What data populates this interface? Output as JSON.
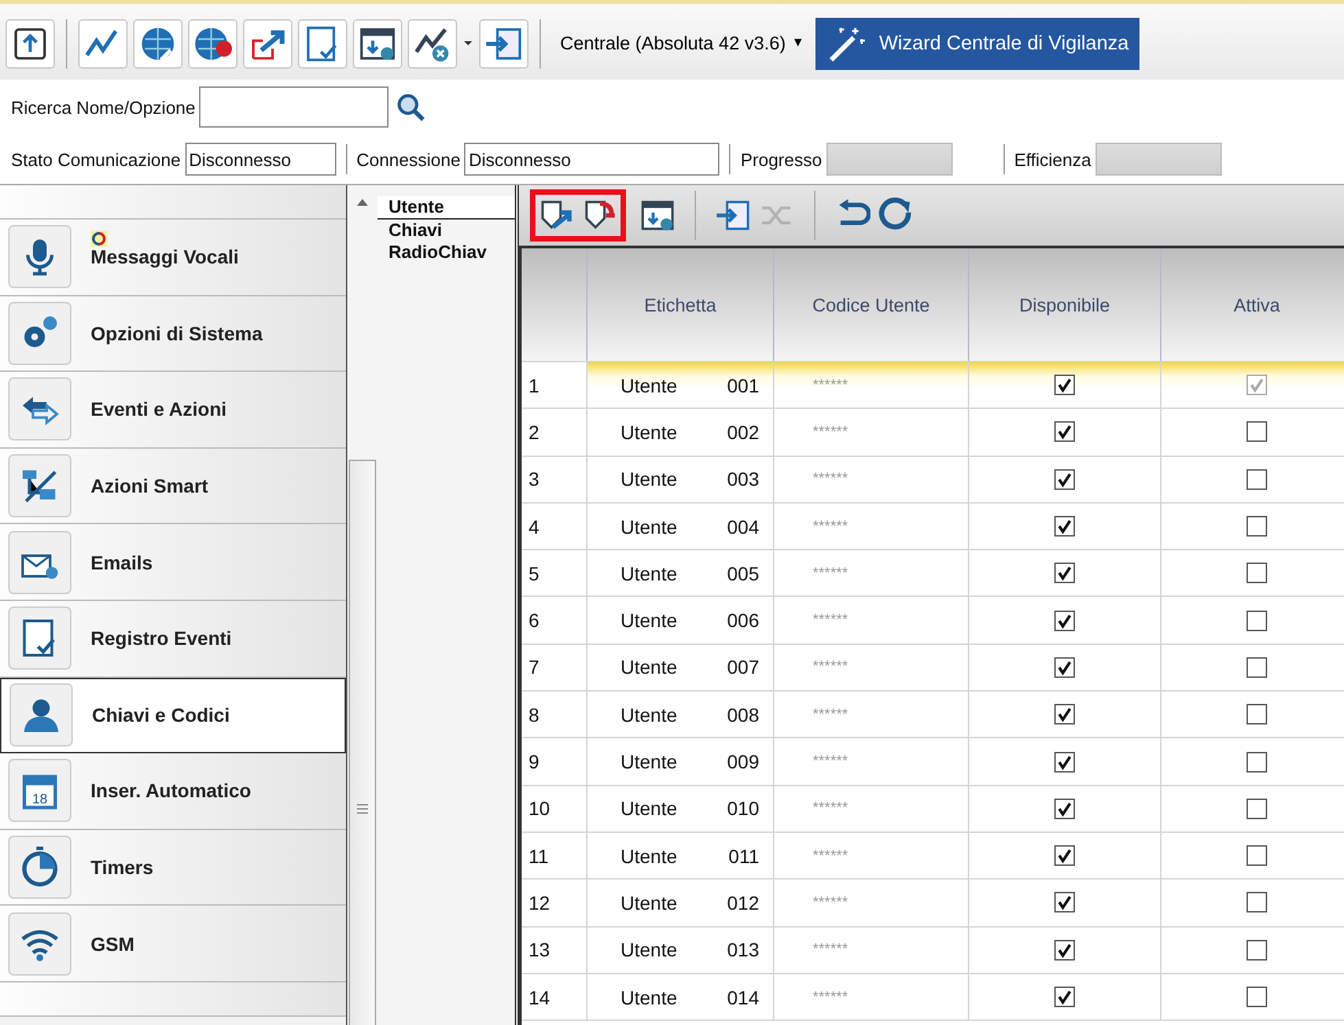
{
  "toolbar": {
    "buttons": [
      {
        "kind": "save"
      },
      {
        "kind": "chart"
      },
      {
        "kind": "globe-up"
      },
      {
        "kind": "globe-down"
      },
      {
        "kind": "export"
      },
      {
        "kind": "checklist"
      },
      {
        "kind": "window-down"
      },
      {
        "kind": "chart-x"
      },
      {
        "kind": "caret"
      },
      {
        "kind": "import"
      }
    ],
    "device": {
      "label": "Centrale (Absoluta 42 v3.6)",
      "caret": "▾"
    },
    "wizard": {
      "label": "Wizard Centrale di Vigilanza"
    }
  },
  "search": {
    "label": "Ricerca Nome/Opzione"
  },
  "status": [
    {
      "kind": "field",
      "label": "Stato Comunicazione",
      "value": "Disconnesso"
    },
    {
      "kind": "field",
      "label": "Connessione",
      "value": "Disconnesso"
    },
    {
      "kind": "bar",
      "label": "Progresso",
      "level": 0
    },
    {
      "kind": "bar",
      "label": "Efficienza",
      "level": 0
    }
  ],
  "sidebar": {
    "items": [
      {
        "kind": "mic",
        "label": "Messaggi Vocali",
        "selected": false,
        "badge": true
      },
      {
        "kind": "gears",
        "label": "Opzioni di Sistema",
        "selected": false,
        "badge": false
      },
      {
        "kind": "arrows",
        "label": "Eventi e Azioni",
        "selected": false,
        "badge": false
      },
      {
        "kind": "smart",
        "label": "Azioni Smart",
        "selected": false,
        "badge": false
      },
      {
        "kind": "email",
        "label": "Emails",
        "selected": false,
        "badge": false
      },
      {
        "kind": "log",
        "label": "Registro Eventi",
        "selected": false,
        "badge": false
      },
      {
        "kind": "user",
        "label": "Chiavi e Codici",
        "selected": true,
        "badge": false
      },
      {
        "kind": "calendar",
        "label": "Inser. Automatico",
        "selected": false,
        "badge": false,
        "icon_text": "18"
      },
      {
        "kind": "timer",
        "label": "Timers",
        "selected": false,
        "badge": false
      },
      {
        "kind": "wifi",
        "label": "GSM",
        "selected": false,
        "badge": false
      }
    ]
  },
  "tree": {
    "items": [
      {
        "label": "Utente",
        "selected": true
      },
      {
        "label": "Chiavi",
        "selected": false
      },
      {
        "label": "RadioChiav",
        "selected": false
      }
    ]
  },
  "grid_toolbar": {
    "groups": [
      {
        "highlighted": true,
        "buttons": [
          {
            "kind": "shield-up",
            "disabled": false
          },
          {
            "kind": "shield-down",
            "disabled": false
          }
        ]
      },
      {
        "highlighted": false,
        "buttons": [
          {
            "kind": "window-down",
            "disabled": false
          }
        ]
      },
      {
        "highlighted": false,
        "buttons": [
          {
            "kind": "import",
            "disabled": false
          },
          {
            "kind": "shuffle",
            "disabled": true
          }
        ]
      },
      {
        "highlighted": false,
        "buttons": [
          {
            "kind": "undo",
            "disabled": false
          },
          {
            "kind": "refresh",
            "disabled": false
          }
        ]
      }
    ]
  },
  "table": {
    "columns": [
      "Etichetta",
      "Codice Utente",
      "Disponibile",
      "Attiva"
    ],
    "rows": [
      {
        "index": "1",
        "label": "Utente",
        "number": "001",
        "code": "******",
        "available": true,
        "active": true,
        "active_disabled": true,
        "selected": true
      },
      {
        "index": "2",
        "label": "Utente",
        "number": "002",
        "code": "******",
        "available": true,
        "active": false,
        "active_disabled": false,
        "selected": false
      },
      {
        "index": "3",
        "label": "Utente",
        "number": "003",
        "code": "******",
        "available": true,
        "active": false,
        "active_disabled": false,
        "selected": false
      },
      {
        "index": "4",
        "label": "Utente",
        "number": "004",
        "code": "******",
        "available": true,
        "active": false,
        "active_disabled": false,
        "selected": false
      },
      {
        "index": "5",
        "label": "Utente",
        "number": "005",
        "code": "******",
        "available": true,
        "active": false,
        "active_disabled": false,
        "selected": false
      },
      {
        "index": "6",
        "label": "Utente",
        "number": "006",
        "code": "******",
        "available": true,
        "active": false,
        "active_disabled": false,
        "selected": false
      },
      {
        "index": "7",
        "label": "Utente",
        "number": "007",
        "code": "******",
        "available": true,
        "active": false,
        "active_disabled": false,
        "selected": false
      },
      {
        "index": "8",
        "label": "Utente",
        "number": "008",
        "code": "******",
        "available": true,
        "active": false,
        "active_disabled": false,
        "selected": false
      },
      {
        "index": "9",
        "label": "Utente",
        "number": "009",
        "code": "******",
        "available": true,
        "active": false,
        "active_disabled": false,
        "selected": false
      },
      {
        "index": "10",
        "label": "Utente",
        "number": "010",
        "code": "******",
        "available": true,
        "active": false,
        "active_disabled": false,
        "selected": false
      },
      {
        "index": "11",
        "label": "Utente",
        "number": "011",
        "code": "******",
        "available": true,
        "active": false,
        "active_disabled": false,
        "selected": false
      },
      {
        "index": "12",
        "label": "Utente",
        "number": "012",
        "code": "******",
        "available": true,
        "active": false,
        "active_disabled": false,
        "selected": false
      },
      {
        "index": "13",
        "label": "Utente",
        "number": "013",
        "code": "******",
        "available": true,
        "active": false,
        "active_disabled": false,
        "selected": false
      },
      {
        "index": "14",
        "label": "Utente",
        "number": "014",
        "code": "******",
        "available": true,
        "active": false,
        "active_disabled": false,
        "selected": false
      }
    ]
  }
}
